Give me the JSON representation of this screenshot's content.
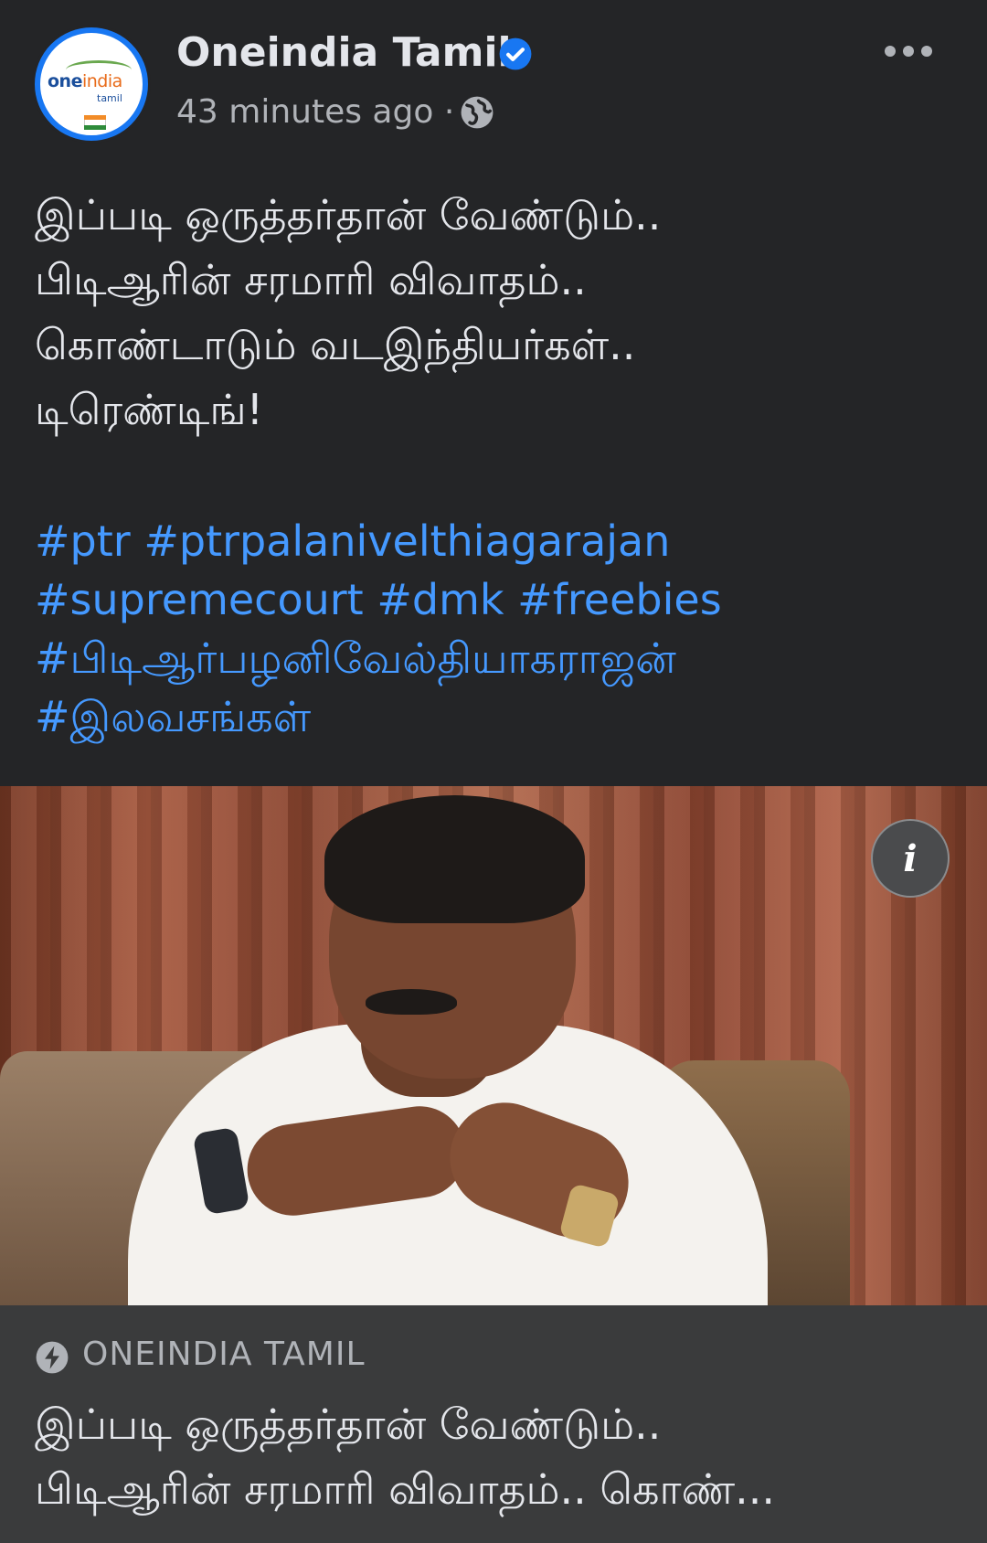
{
  "header": {
    "page_name": "Oneindia Tamil",
    "time": "43 minutes ago",
    "separator": "·",
    "avatar": {
      "logo_word_a": "one",
      "logo_word_b": "india",
      "logo_sub": "tamil"
    },
    "icons": [
      "verified-badge-icon",
      "globe-icon",
      "more-options-icon"
    ]
  },
  "post": {
    "lines": [
      "இப்படி ஒருத்தர்தான் வேண்டும்..",
      "பிடிஆரின் சரமாரி விவாதம்..",
      "கொண்டாடும் வடஇந்தியர்கள்..",
      "டிரெண்டிங்!"
    ],
    "hashtag_lines": [
      [
        "#ptr",
        "#ptrpalanivelthiagarajan"
      ],
      [
        "#supremecourt",
        "#dmk",
        "#freebies"
      ],
      [
        "#பிடிஆர்பழனிவேல்தியாகராஜன்"
      ],
      [
        "#இலவசங்கள்"
      ]
    ]
  },
  "media": {
    "info_button": "i"
  },
  "link_preview": {
    "source": "ONEINDIA TAMIL",
    "title_lines": [
      "இப்படி ஒருத்தர்தான் வேண்டும்..",
      "பிடிஆரின் சரமாரி விவாதம்.. கொண்..."
    ]
  },
  "colors": {
    "background": "#242527",
    "card": "#3a3b3c",
    "text": "#e4e6eb",
    "muted": "#b0b3b8",
    "hashtag": "#4599ff",
    "verified": "#1877f2"
  }
}
